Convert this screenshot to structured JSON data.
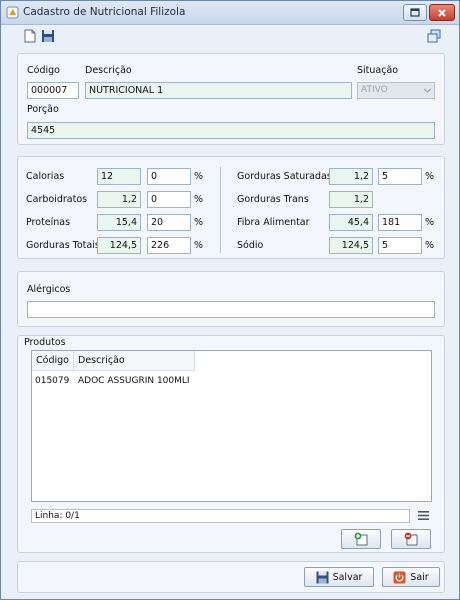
{
  "window": {
    "title": "Cadastro de Nutricional Filizola"
  },
  "identity": {
    "codigo_label": "Código",
    "codigo_value": "000007",
    "descricao_label": "Descrição",
    "descricao_value": "NUTRICIONAL 1",
    "situacao_label": "Situação",
    "situacao_value": "ATIVO",
    "porcao_label": "Porção",
    "porcao_value": "4545"
  },
  "nutrients_left": [
    {
      "label": "Calorias",
      "value": "12",
      "percent": "0",
      "unit": "%"
    },
    {
      "label": "Carboidratos",
      "value": "1,2",
      "percent": "0",
      "unit": "%"
    },
    {
      "label": "Proteínas",
      "value": "15,4",
      "percent": "20",
      "unit": "%"
    },
    {
      "label": "Gorduras Totais",
      "value": "124,5",
      "percent": "226",
      "unit": "%"
    }
  ],
  "nutrients_right": [
    {
      "label": "Gorduras Saturadas",
      "value": "1,2",
      "percent": "5",
      "unit": "%"
    },
    {
      "label": "Gorduras Trans",
      "value": "1,2"
    },
    {
      "label": "Fibra Alimentar",
      "value": "45,4",
      "percent": "181",
      "unit": "%"
    },
    {
      "label": "Sódio",
      "value": "124,5",
      "percent": "5",
      "unit": "%"
    }
  ],
  "alergicos": {
    "label": "Alérgicos",
    "value": ""
  },
  "produtos": {
    "label": "Produtos",
    "columns": [
      "Código",
      "Descrição"
    ],
    "rows": [
      {
        "codigo": "015079",
        "descricao": "ADOC ASSUGRIN 100MLI"
      }
    ],
    "status": "Linha: 0/1"
  },
  "footer": {
    "save_label": "Salvar",
    "exit_label": "Sair"
  },
  "colors": {
    "field_bg": "#e9f6ee",
    "window_bg": "#eaf0f7",
    "close_red": "#c4412c"
  }
}
